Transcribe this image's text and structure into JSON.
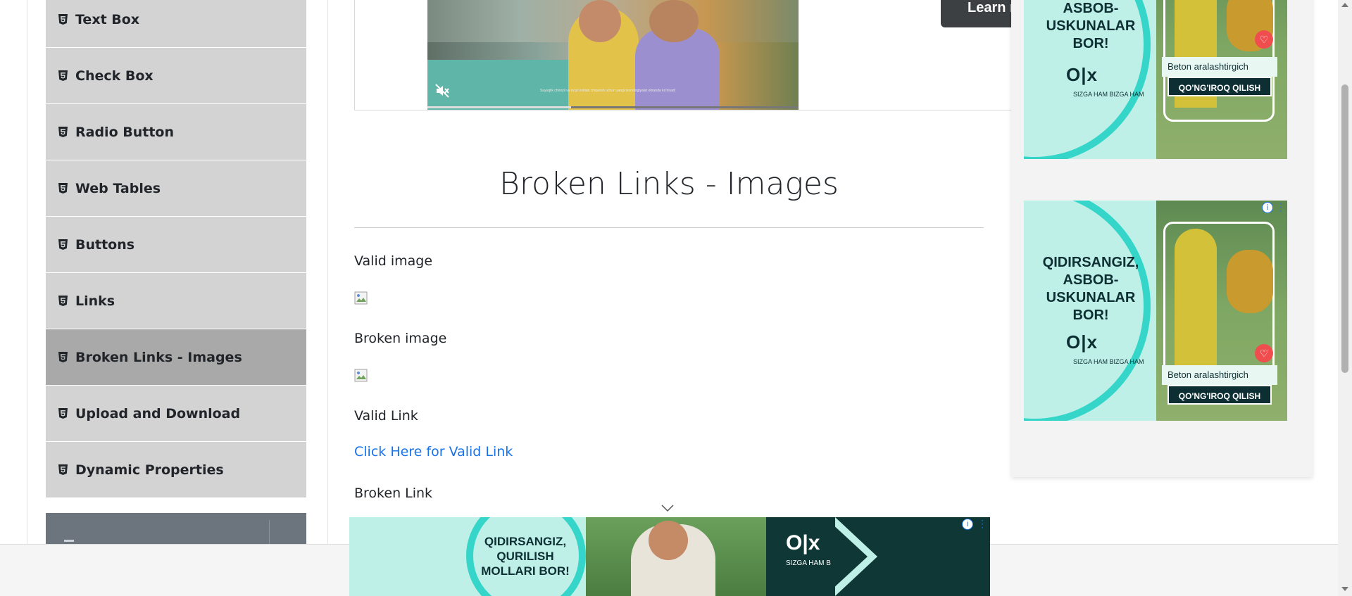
{
  "sidebar": {
    "items": [
      {
        "label": "Text Box",
        "icon": "html5-icon"
      },
      {
        "label": "Check Box",
        "icon": "html5-icon"
      },
      {
        "label": "Radio Button",
        "icon": "html5-icon"
      },
      {
        "label": "Web Tables",
        "icon": "html5-icon"
      },
      {
        "label": "Buttons",
        "icon": "html5-icon"
      },
      {
        "label": "Links",
        "icon": "html5-icon"
      },
      {
        "label": "Broken Links - Images",
        "icon": "html5-icon",
        "active": true
      },
      {
        "label": "Upload and Download",
        "icon": "html5-icon"
      },
      {
        "label": "Dynamic Properties",
        "icon": "html5-icon"
      }
    ],
    "colors": {
      "item_bg": "#d3d3d3",
      "active_bg": "#a9a9a9",
      "group_header_bg": "#6c757d"
    }
  },
  "video_ad": {
    "learn_more_label": "Learn mo",
    "caption": "Suyuqlik chiroyli va to‘g‘ri ishlab chiqarish uchun yangi texnologiyalar ekranda ko‘rinadi",
    "progress_fraction": 0.39,
    "muted": true
  },
  "main": {
    "title": "Broken Links - Images",
    "valid_image_label": "Valid image",
    "broken_image_label": "Broken image",
    "valid_link_label": "Valid Link",
    "valid_link_text": "Click Here for Valid Link",
    "broken_link_label": "Broken Link",
    "link_color": "#1a73e8"
  },
  "side_ads": [
    {
      "headline": "QIDIRSANGIZ, ASBOB-USKUNALAR BOR!",
      "logo": "O|x",
      "sub": "SIZGA HAM BIZGA HAM",
      "product": "Beton aralashtirgich",
      "cta": "QO'NG'IROQ QILISH"
    },
    {
      "headline": "QIDIRSANGIZ, ASBOB-USKUNALAR BOR!",
      "logo": "O|x",
      "sub": "SIZGA HAM BIZGA HAM",
      "product": "Beton aralashtirgich",
      "cta": "QO'NG'IROQ QILISH"
    }
  ],
  "bottom_ad": {
    "headline": "QIDIRSANGIZ, QURILISH MOLLARI BOR!",
    "logo": "O|x",
    "sub": "SIZGA HAM BIZGA HAM"
  },
  "brand_colors": {
    "olx_teal": "#35d6c9",
    "olx_dark": "#0d2f33"
  }
}
